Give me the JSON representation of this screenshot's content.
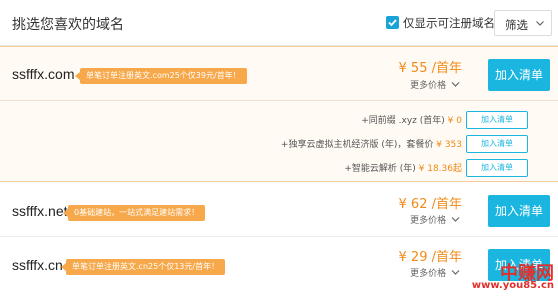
{
  "header": {
    "title": "挑选您喜欢的域名",
    "only_available_label": "仅显示可注册域名",
    "only_available_checked": true,
    "filter_label": "筛选"
  },
  "featured": {
    "domain": "ssfffx.com",
    "promo": "单笔订单注册英文.com25个仅39元/首年！",
    "price": "¥ 55 /首年",
    "more_prices": "更多价格",
    "add_label": "加入清单",
    "addons": [
      {
        "text": "+同前缀 .xyz (首年)",
        "price": "¥ 0",
        "button": "加入清单"
      },
      {
        "text": "+独享云虚拟主机经济版 (年)，套餐价",
        "price": "¥ 353",
        "button": "加入清单"
      },
      {
        "text": "+智能云解析 (年)",
        "price": "¥ 18.36起",
        "button": "加入清单"
      }
    ]
  },
  "results": [
    {
      "domain": "ssfffx.net",
      "promo": "0基础建站，一站式满足建站需求！",
      "price": "¥ 62 /首年",
      "more_prices": "更多价格",
      "add_label": "加入清单"
    },
    {
      "domain": "ssfffx.cn",
      "promo": "单笔订单注册英文.cn25个仅13元/首年！",
      "price": "¥ 29 /首年",
      "more_prices": "更多价格",
      "add_label": "加入清单"
    }
  ],
  "watermark": {
    "line1": "中赚网",
    "line2": "www.you85.cn"
  },
  "colors": {
    "accent": "#1bb6e0",
    "price": "#f08b18",
    "promo": "#f7a84a",
    "watermark": "#e0302b"
  }
}
